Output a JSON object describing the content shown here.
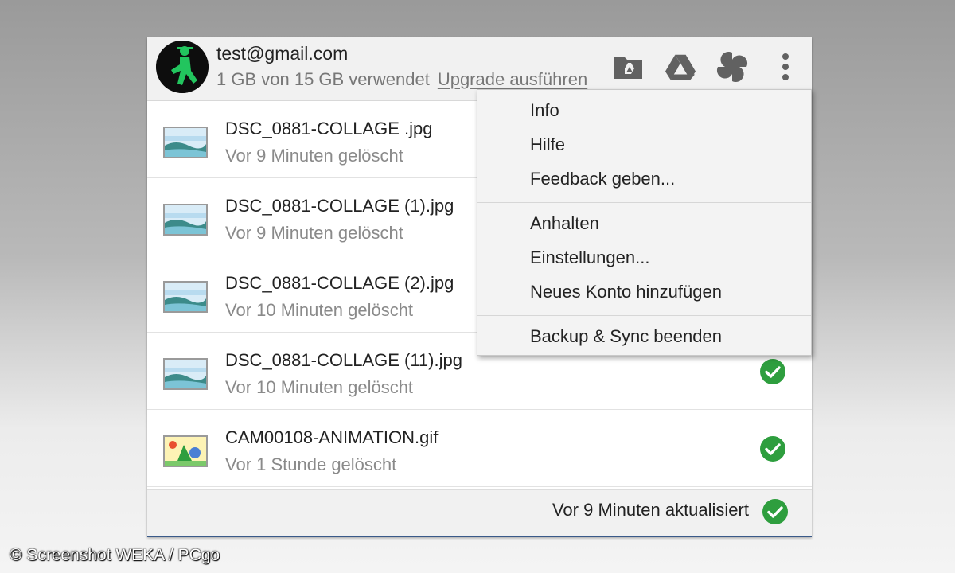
{
  "account": {
    "email": "test@gmail.com",
    "usage": "1 GB von 15 GB verwendet",
    "upgrade_label": "Upgrade ausführen"
  },
  "header_icons": [
    "drive-folder-icon",
    "google-drive-icon",
    "google-photos-icon",
    "more-vert-icon"
  ],
  "files": [
    {
      "name": "DSC_0881-COLLAGE .jpg",
      "time": "Vor 9 Minuten gelöscht",
      "thumb": "image-icon",
      "synced": false
    },
    {
      "name": "DSC_0881-COLLAGE (1).jpg",
      "time": "Vor 9 Minuten gelöscht",
      "thumb": "image-icon",
      "synced": false
    },
    {
      "name": "DSC_0881-COLLAGE (2).jpg",
      "time": "Vor 10 Minuten gelöscht",
      "thumb": "image-icon",
      "synced": false
    },
    {
      "name": "DSC_0881-COLLAGE (11).jpg",
      "time": "Vor 10 Minuten gelöscht",
      "thumb": "image-icon",
      "synced": true
    },
    {
      "name": "CAM00108-ANIMATION.gif",
      "time": "Vor 1 Stunde gelöscht",
      "thumb": "animation-icon",
      "synced": true
    }
  ],
  "footer": {
    "status": "Vor 9 Minuten aktualisiert"
  },
  "menu": {
    "group1": [
      "Info",
      "Hilfe",
      "Feedback geben..."
    ],
    "group2": [
      "Anhalten",
      "Einstellungen...",
      "Neues Konto hinzufügen"
    ],
    "group3": [
      "Backup & Sync beenden"
    ]
  },
  "credit": "© Screenshot WEKA / PCgo",
  "colors": {
    "check_green": "#2e9e3e",
    "header_bg": "#f1f1f1",
    "icon_gray": "#616161"
  }
}
